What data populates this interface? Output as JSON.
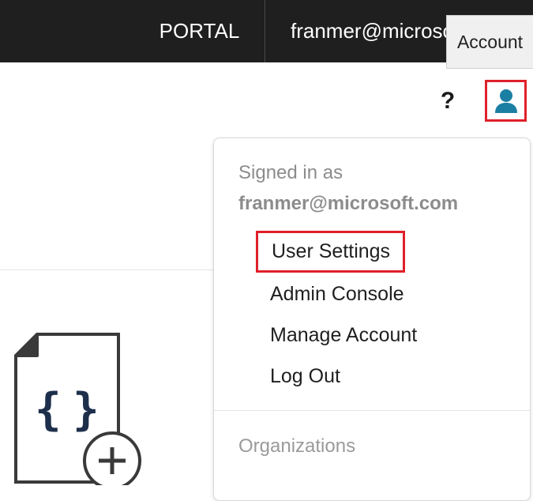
{
  "topbar": {
    "portal_label": "PORTAL",
    "user_email": "franmer@microsoft.com"
  },
  "tooltip": {
    "text": "Account"
  },
  "toolbar": {
    "help_label": "?",
    "account_icon": "user-icon"
  },
  "dropdown": {
    "signed_in_label": "Signed in as",
    "signed_in_email": "franmer@microsoft.com",
    "items": [
      {
        "label": "User Settings",
        "highlighted": true
      },
      {
        "label": "Admin Console",
        "highlighted": false
      },
      {
        "label": "Manage Account",
        "highlighted": false
      },
      {
        "label": "Log Out",
        "highlighted": false
      }
    ],
    "section_heading": "Organizations"
  },
  "illustration": {
    "icon": "new-json-file-icon",
    "glyph": "{ }"
  },
  "colors": {
    "topbar_bg": "#1f1f1f",
    "highlight_border": "#e0202a",
    "account_icon": "#1b7fa3",
    "braces": "#1e2f4c"
  }
}
